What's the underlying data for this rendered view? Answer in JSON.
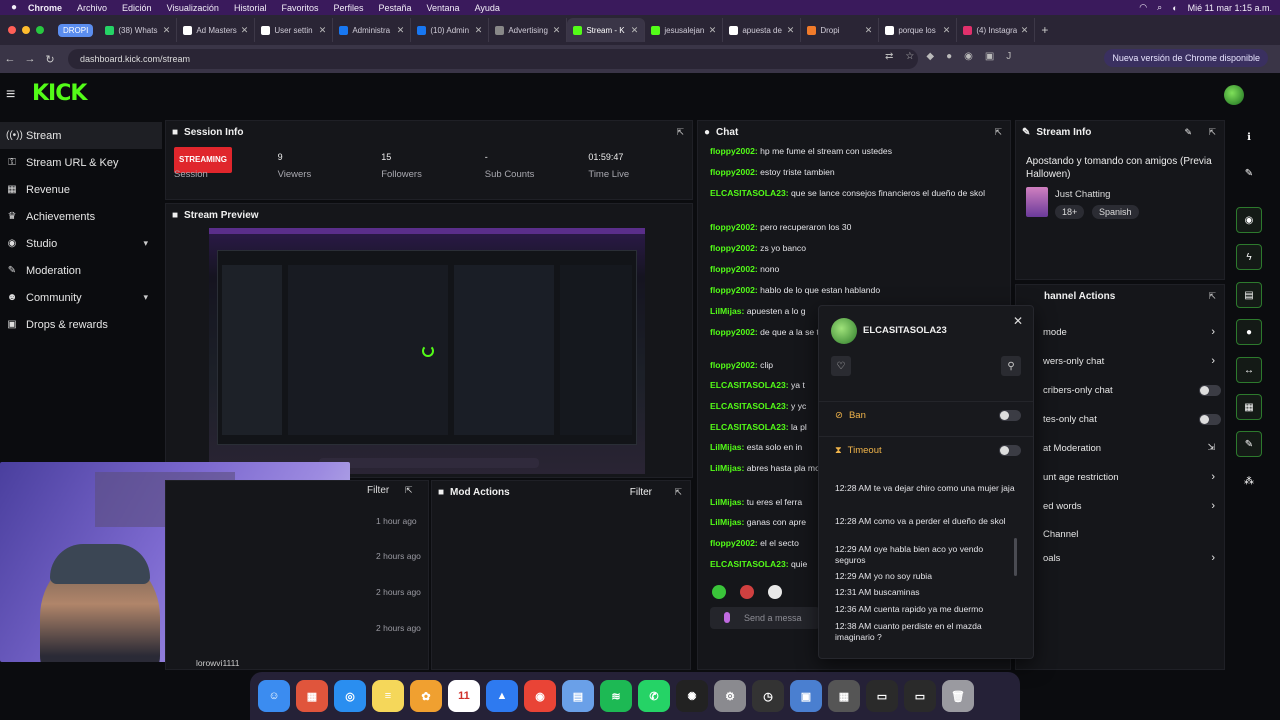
{
  "menubar": {
    "apple": "",
    "items": [
      "Chrome",
      "Archivo",
      "Edición",
      "Visualización",
      "Historial",
      "Favoritos",
      "Perfiles",
      "Pestaña",
      "Ventana",
      "Ayuda"
    ],
    "datetime": "Mié 11 mar  1:15 a.m."
  },
  "tabs": {
    "group_label": "DROPI",
    "items": [
      {
        "label": "(38) Whats",
        "color": "#25d366"
      },
      {
        "label": "Ad Masters",
        "color": "#ffffff"
      },
      {
        "label": "User settin",
        "color": "#ffffff"
      },
      {
        "label": "Administra",
        "color": "#1877f2"
      },
      {
        "label": "(10) Admin",
        "color": "#1877f2"
      },
      {
        "label": "Advertising",
        "color": "#888888"
      },
      {
        "label": "Stream - K",
        "color": "#53fc18"
      },
      {
        "label": "jesusalejan",
        "color": "#53fc18"
      },
      {
        "label": "apuesta de",
        "color": "#ffffff"
      },
      {
        "label": "Dropi",
        "color": "#f07a2a"
      },
      {
        "label": "porque los",
        "color": "#ffffff"
      },
      {
        "label": "(4) Instagra",
        "color": "#e1306c"
      }
    ],
    "active_index": 6
  },
  "address": {
    "url": "dashboard.kick.com/stream",
    "update_label": "Nueva versión de Chrome disponible"
  },
  "brand": {
    "logo": "KICK",
    "accent": "#53fc18"
  },
  "sidebar": {
    "items": [
      {
        "label": "Stream",
        "icon": "broadcast-icon",
        "glyph": "((•))",
        "active": true
      },
      {
        "label": "Stream URL & Key",
        "icon": "key-icon",
        "glyph": "⚿"
      },
      {
        "label": "Revenue",
        "icon": "revenue-icon",
        "glyph": "▦"
      },
      {
        "label": "Achievements",
        "icon": "trophy-icon",
        "glyph": "♛"
      },
      {
        "label": "Studio",
        "icon": "studio-icon",
        "glyph": "◉",
        "chevron": "▾"
      },
      {
        "label": "Moderation",
        "icon": "wrench-icon",
        "glyph": "✎"
      },
      {
        "label": "Community",
        "icon": "community-icon",
        "glyph": "☻",
        "chevron": "▾"
      },
      {
        "label": "Drops & rewards",
        "icon": "gift-icon",
        "glyph": "▣"
      }
    ]
  },
  "session": {
    "title": "Session Info",
    "status": "STREAMING",
    "session_label": "Session",
    "stats": [
      {
        "value": "9",
        "label": "Viewers"
      },
      {
        "value": "15",
        "label": "Followers"
      },
      {
        "value": "-",
        "label": "Sub Counts"
      },
      {
        "value": "01:59:47",
        "label": "Time Live"
      }
    ]
  },
  "preview": {
    "title": "Stream Preview"
  },
  "lower_left": {
    "filter_label": "Filter",
    "times": [
      "1 hour ago",
      "2 hours ago",
      "2 hours ago",
      "2 hours ago"
    ],
    "cut_text": "lorowvi1111"
  },
  "mod_actions": {
    "title": "Mod Actions",
    "filter_label": "Filter"
  },
  "chat": {
    "title": "Chat",
    "messages": [
      {
        "user": "floppy2002:",
        "text": " hp me fume el stream con ustedes",
        "color": "#53fc18"
      },
      {
        "user": "floppy2002:",
        "text": " estoy triste tambien",
        "color": "#53fc18"
      },
      {
        "user": "ELCASITASOLA23:",
        "text": " que se lance consejos financieros el dueño de skol",
        "color": "#53fc18"
      },
      {
        "user": "floppy2002:",
        "text": " pero recuperaron los 30",
        "color": "#53fc18"
      },
      {
        "user": "floppy2002:",
        "text": " zs yo banco",
        "color": "#53fc18"
      },
      {
        "user": "floppy2002:",
        "text": " nono",
        "color": "#53fc18"
      },
      {
        "user": "floppy2002:",
        "text": " hablo de lo que estan hablando",
        "color": "#53fc18"
      },
      {
        "user": "LilMijas:",
        "text": " apuesten a lo g",
        "color": "#53fc18"
      },
      {
        "user": "floppy2002:",
        "text": " de que a la se trata",
        "color": "#53fc18"
      },
      {
        "user": "floppy2002:",
        "text": " clip",
        "color": "#53fc18"
      },
      {
        "user": "ELCASITASOLA23:",
        "text": " ya t",
        "color": "#53fc18"
      },
      {
        "user": "ELCASITASOLA23:",
        "text": " y yc",
        "color": "#53fc18"
      },
      {
        "user": "ELCASITASOLA23:",
        "text": " la pl",
        "color": "#53fc18"
      },
      {
        "user": "LilMijas:",
        "text": " esta solo en in",
        "color": "#53fc18"
      },
      {
        "user": "LilMijas:",
        "text": " abres hasta pla money",
        "color": "#53fc18"
      },
      {
        "user": "LilMijas:",
        "text": " tu eres el ferra",
        "color": "#53fc18"
      },
      {
        "user": "LilMijas:",
        "text": " ganas con apre",
        "color": "#53fc18"
      },
      {
        "user": "floppy2002:",
        "text": " el el secto",
        "color": "#53fc18"
      },
      {
        "user": "ELCASITASOLA23:",
        "text": " quie",
        "color": "#53fc18"
      }
    ],
    "send_placeholder": "Send a messa"
  },
  "stream_info": {
    "title": "Stream Info",
    "stream_title": "Apostando y tomando con amigos (Previa Hallowen)",
    "category": "Just Chatting",
    "tags": [
      "18+",
      "Spanish"
    ]
  },
  "channel_actions": {
    "title": "hannel Actions",
    "items": [
      {
        "label": "mode",
        "control": "arrow"
      },
      {
        "label": "wers-only chat",
        "control": "arrow"
      },
      {
        "label": "cribers-only chat",
        "control": "toggle"
      },
      {
        "label": "tes-only chat",
        "control": "toggle"
      },
      {
        "label": "at Moderation",
        "control": "external"
      },
      {
        "label": "unt age restriction",
        "control": "arrow"
      },
      {
        "label": "ed words",
        "control": "arrow"
      },
      {
        "label": "Channel",
        "control": "none"
      },
      {
        "label": "oals",
        "control": "arrow"
      }
    ]
  },
  "user_popup": {
    "username": "ELCASITASOLA23",
    "ban_label": "Ban",
    "timeout_label": "Timeout",
    "messages": [
      {
        "time": "12:28 AM",
        "text": "te va dejar chiro como una mujer jaja"
      },
      {
        "time": "12:28 AM",
        "text": "como va a perder el dueño de skol"
      },
      {
        "time": "12:29 AM",
        "text": "oye habla bien aco yo vendo seguros"
      },
      {
        "time": "12:29 AM",
        "text": "yo no soy rubia"
      },
      {
        "time": "12:31 AM",
        "text": "buscaminas"
      },
      {
        "time": "12:36 AM",
        "text": "cuenta rapido ya me duermo"
      },
      {
        "time": "12:38 AM",
        "text": "cuanto perdiste en el mazda imaginario ?"
      }
    ]
  },
  "dock": {
    "apps": [
      {
        "name": "finder-icon",
        "color": "#3b8cf0",
        "glyph": "☺"
      },
      {
        "name": "launchpad-icon",
        "color": "#e0553c",
        "glyph": "▦"
      },
      {
        "name": "safari-icon",
        "color": "#2a8ef0",
        "glyph": "◎"
      },
      {
        "name": "notes-icon",
        "color": "#f5d75a",
        "glyph": "≡"
      },
      {
        "name": "photos-icon",
        "color": "#f0a030",
        "glyph": "✿"
      },
      {
        "name": "calendar-icon",
        "color": "#ffffff",
        "glyph": "11"
      },
      {
        "name": "keynote-icon",
        "color": "#2e7af0",
        "glyph": "▲"
      },
      {
        "name": "chrome-icon",
        "color": "#e94436",
        "glyph": "◉"
      },
      {
        "name": "files-icon",
        "color": "#6aa0e8",
        "glyph": "▤"
      },
      {
        "name": "spotify-icon",
        "color": "#1db954",
        "glyph": "≋"
      },
      {
        "name": "whatsapp-icon",
        "color": "#25d366",
        "glyph": "✆"
      },
      {
        "name": "chatgpt-icon",
        "color": "#222222",
        "glyph": "✺"
      },
      {
        "name": "settings-icon",
        "color": "#8a8a8f",
        "glyph": "⚙"
      },
      {
        "name": "activity-icon",
        "color": "#333333",
        "glyph": "◷"
      },
      {
        "name": "preview-icon",
        "color": "#4a7fd0",
        "glyph": "▣"
      },
      {
        "name": "calculator-icon",
        "color": "#555555",
        "glyph": "▦"
      },
      {
        "name": "window-icon",
        "color": "#2a2a2a",
        "glyph": "▭"
      },
      {
        "name": "window-icon-2",
        "color": "#2a2a2a",
        "glyph": "▭"
      },
      {
        "name": "trash-icon",
        "color": "#9a9aa0",
        "glyph": "🗑"
      }
    ]
  }
}
